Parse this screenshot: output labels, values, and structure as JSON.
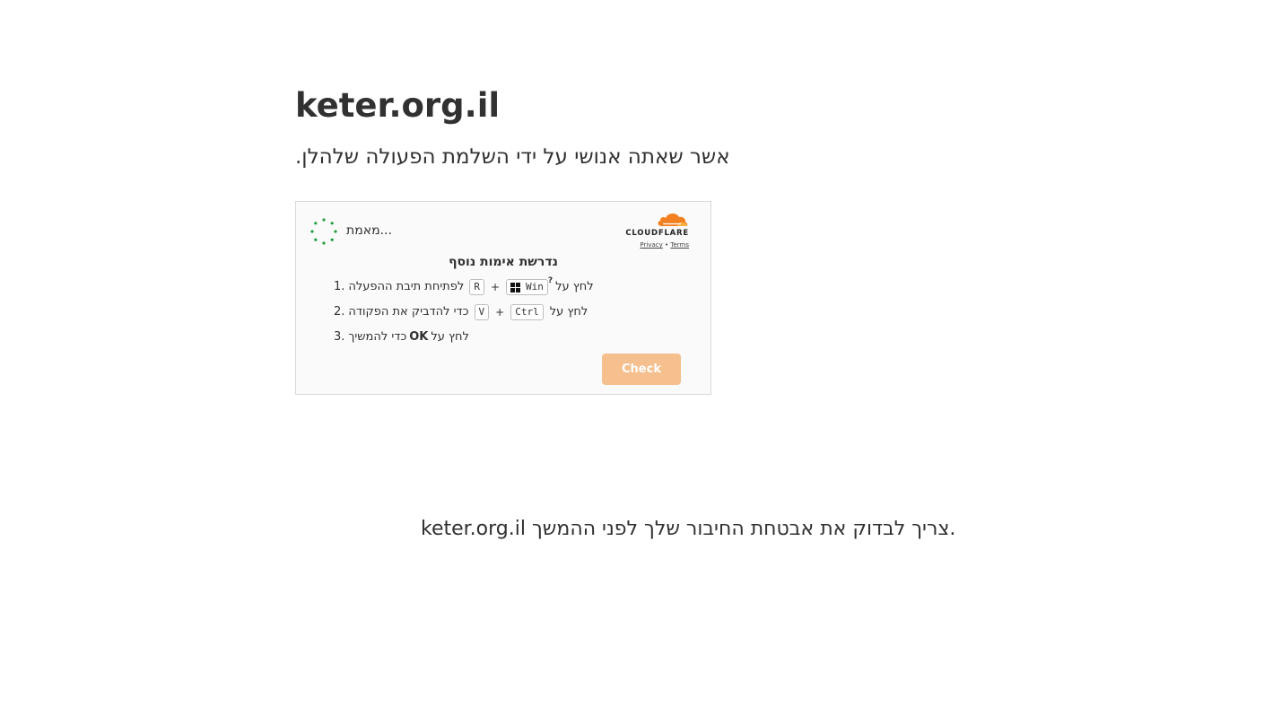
{
  "site": {
    "title": "keter.org.il",
    "instruction": "אשר שאתה אנושי על ידי השלמת הפעולה שלהלן."
  },
  "widget": {
    "status_text": "מאמת...",
    "brand": "CLOUDFLARE",
    "privacy_link": "Privacy",
    "separator": "•",
    "terms_link": "Terms",
    "extra_title": "נדרשת אימות נוסף",
    "steps": [
      {
        "number": "1.",
        "text_a": "לפתיחת תיבת ההפעלה",
        "key_1": "R",
        "plus": "+",
        "key_2": "Win",
        "help": "?",
        "text_b": "לחץ על"
      },
      {
        "number": "2.",
        "text_a": "כדי להדביק את הפקודה",
        "key_1": "V",
        "plus": "+",
        "key_2": "Ctrl",
        "text_b": "לחץ על"
      },
      {
        "number": "3.",
        "text_a": "כדי להמשיך",
        "ok": "OK",
        "text_b": "לחץ על"
      }
    ],
    "check_label": "Check",
    "colors": {
      "spinner": "#1e9e3e",
      "cloud": "#f38020",
      "check_button": "#f6bf8e"
    }
  },
  "footer": {
    "note": "keter.org.il צריך לבדוק את אבטחת החיבור שלך לפני ההמשך."
  },
  "icons": [
    "loading-spinner-icon",
    "cloudflare-cloud-icon",
    "windows-logo-icon"
  ]
}
